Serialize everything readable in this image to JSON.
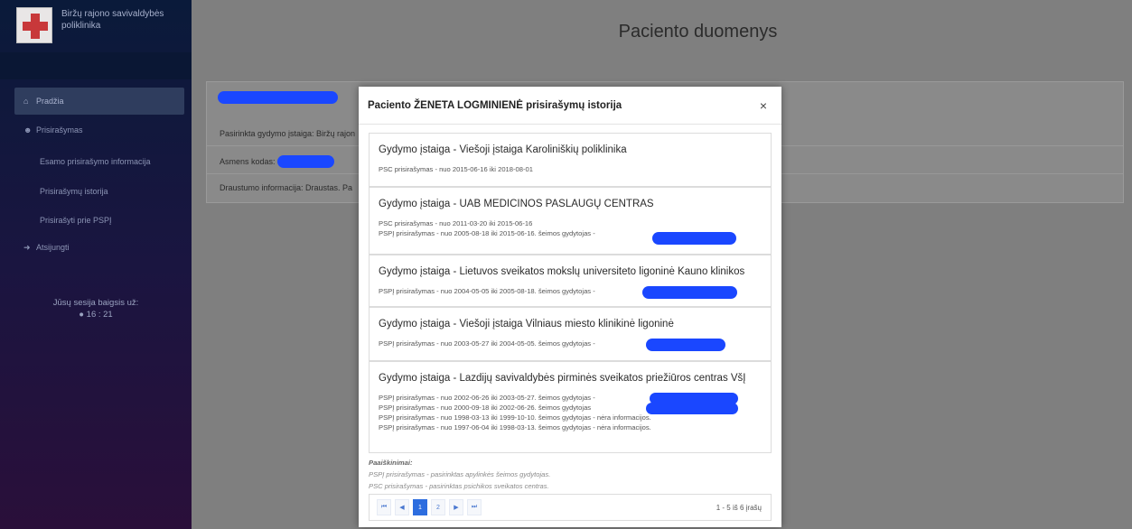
{
  "sidebar": {
    "brand": "Biržų rajono savivaldybės poliklinika",
    "items": [
      {
        "label": "Pradžia",
        "icon": "home-icon"
      },
      {
        "label": "Prisirašymas",
        "icon": "user-plus-icon"
      },
      {
        "label": "Esamo prisirašymo informacija"
      },
      {
        "label": "Prisirašymų istorija"
      },
      {
        "label": "Prisirašyti prie PSPĮ"
      },
      {
        "label": "Atsijungti",
        "icon": "sign-out-icon"
      }
    ],
    "session_label": "Jūsų sesija baigsis už:",
    "session_time": "16 : 21"
  },
  "main": {
    "title": "Paciento duomenys",
    "rows": [
      "Pasirinkta gydymo įstaiga: Biržų rajon",
      "Asmens kodas:",
      "Draustumo informacija: Draustas. Pa"
    ]
  },
  "modal": {
    "title": "Paciento ŽENETA LOGMINIENĖ prisirašymų istorija",
    "close": "×",
    "entries": [
      {
        "title": "Gydymo įstaiga - Viešoji įstaiga Karoliniškių poliklinika",
        "lines": [
          "PSC prisirašymas - nuo 2015-06-16 iki 2018-08-01"
        ]
      },
      {
        "title": "Gydymo įstaiga - UAB MEDICINOS PASLAUGŲ CENTRAS",
        "lines": [
          "PSC prisirašymas - nuo 2011-03-20 iki 2015-06-16",
          "PSPĮ prisirašymas - nuo 2005-08-18 iki 2015-06-16. šeimos gydytojas -"
        ]
      },
      {
        "title": "Gydymo įstaiga - Lietuvos sveikatos mokslų universiteto ligoninė Kauno klinikos",
        "lines": [
          "PSPĮ prisirašymas - nuo 2004-05-05 iki 2005-08-18. šeimos gydytojas -"
        ]
      },
      {
        "title": "Gydymo įstaiga - Viešoji įstaiga Vilniaus miesto klinikinė ligoninė",
        "lines": [
          "PSPĮ prisirašymas - nuo 2003-05-27 iki 2004-05-05. šeimos gydytojas -"
        ]
      },
      {
        "title": "Gydymo įstaiga - Lazdijų savivaldybės pirminės sveikatos priežiūros centras VšĮ",
        "lines": [
          "PSPĮ prisirašymas - nuo 2002-06-26 iki 2003-05-27. šeimos gydytojas -",
          "PSPĮ prisirašymas - nuo 2000-09-18 iki 2002-06-26. šeimos gydytojas",
          "PSPĮ prisirašymas - nuo 1998-03-13 iki 1999-10-10. šeimos gydytojas - nėra informacijos.",
          "PSPĮ prisirašymas - nuo 1997-06-04 iki 1998-03-13. šeimos gydytojas - nėra informacijos."
        ]
      }
    ],
    "notes": {
      "heading": "Paaiškinimai:",
      "lines": [
        "PSPĮ prisirašymas - pasirinktas apylinkės šeimos gydytojas.",
        "PSC prisirašymas - pasirinktas psichikos sveikatos centras."
      ]
    },
    "pager": {
      "first": "⏮",
      "prev": "◀",
      "pages": [
        "1",
        "2"
      ],
      "current": "1",
      "next": "▶",
      "last": "⏭",
      "count": "1 - 5 iš 6 įrašų"
    }
  },
  "colors": {
    "accent": "#2d6ddf",
    "redaction": "#1a47ff",
    "sidebar_top": "#0a1a3a",
    "overlay": "#7f7f7f"
  }
}
